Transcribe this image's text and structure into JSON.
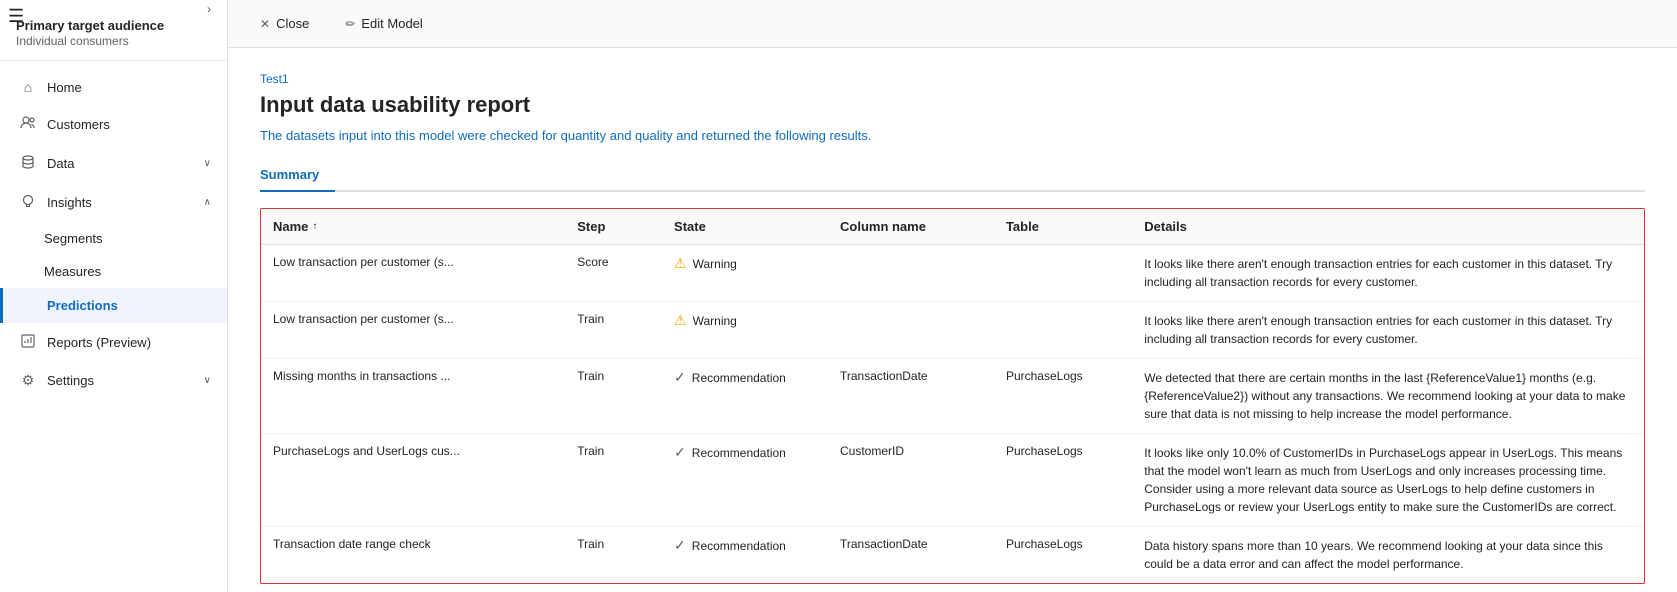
{
  "sidebar": {
    "header": {
      "title": "Primary target audience",
      "subtitle": "Individual consumers"
    },
    "nav_items": [
      {
        "id": "home",
        "label": "Home",
        "icon": "⌂",
        "active": false,
        "has_chevron": false
      },
      {
        "id": "customers",
        "label": "Customers",
        "icon": "👤",
        "active": false,
        "has_chevron": false
      },
      {
        "id": "data",
        "label": "Data",
        "icon": "🗄",
        "active": false,
        "has_chevron": true,
        "chevron": "∨"
      },
      {
        "id": "insights",
        "label": "Insights",
        "icon": "💡",
        "active": false,
        "has_chevron": true,
        "chevron": "∧"
      },
      {
        "id": "segments",
        "label": "Segments",
        "sub": true
      },
      {
        "id": "measures",
        "label": "Measures",
        "sub": false,
        "indent": true
      },
      {
        "id": "predictions",
        "label": "Predictions",
        "active": true,
        "indent": true
      },
      {
        "id": "reports",
        "label": "Reports (Preview)",
        "icon": "📊",
        "active": false,
        "has_chevron": false
      },
      {
        "id": "settings",
        "label": "Settings",
        "icon": "⚙",
        "active": false,
        "has_chevron": true,
        "chevron": "∨"
      }
    ]
  },
  "topbar": {
    "close_label": "Close",
    "edit_label": "Edit Model"
  },
  "content": {
    "breadcrumb": "Test1",
    "title": "Input data usability report",
    "description": "The datasets input into this model were checked for quantity and quality and returned the following results.",
    "tabs": [
      {
        "id": "summary",
        "label": "Summary",
        "active": true
      }
    ],
    "table": {
      "columns": [
        {
          "id": "name",
          "label": "Name",
          "sort": "↑"
        },
        {
          "id": "step",
          "label": "Step"
        },
        {
          "id": "state",
          "label": "State"
        },
        {
          "id": "column_name",
          "label": "Column name"
        },
        {
          "id": "table",
          "label": "Table"
        },
        {
          "id": "details",
          "label": "Details"
        }
      ],
      "rows": [
        {
          "name": "Low transaction per customer (s...",
          "step": "Score",
          "state": "Warning",
          "state_type": "warning",
          "column_name": "",
          "table": "",
          "details": "It looks like there aren't enough transaction entries for each customer in this dataset. Try including all transaction records for every customer."
        },
        {
          "name": "Low transaction per customer (s...",
          "step": "Train",
          "state": "Warning",
          "state_type": "warning",
          "column_name": "",
          "table": "",
          "details": "It looks like there aren't enough transaction entries for each customer in this dataset. Try including all transaction records for every customer."
        },
        {
          "name": "Missing months in transactions ...",
          "step": "Train",
          "state": "Recommendation",
          "state_type": "recommendation",
          "column_name": "TransactionDate",
          "table": "PurchaseLogs",
          "details": "We detected that there are certain months in the last {ReferenceValue1} months (e.g. {ReferenceValue2}) without any transactions. We recommend looking at your data to make sure that data is not missing to help increase the model performance."
        },
        {
          "name": "PurchaseLogs and UserLogs cus...",
          "step": "Train",
          "state": "Recommendation",
          "state_type": "recommendation",
          "column_name": "CustomerID",
          "table": "PurchaseLogs",
          "details": "It looks like only 10.0% of CustomerIDs in PurchaseLogs appear in UserLogs. This means that the model won't learn as much from UserLogs and only increases processing time. Consider using a more relevant data source as UserLogs to help define customers in PurchaseLogs or review your UserLogs entity to make sure the CustomerIDs are correct."
        },
        {
          "name": "Transaction date range check",
          "step": "Train",
          "state": "Recommendation",
          "state_type": "recommendation",
          "column_name": "TransactionDate",
          "table": "PurchaseLogs",
          "details": "Data history spans more than 10 years. We recommend looking at your data since this could be a data error and can affect the model performance."
        }
      ]
    }
  }
}
